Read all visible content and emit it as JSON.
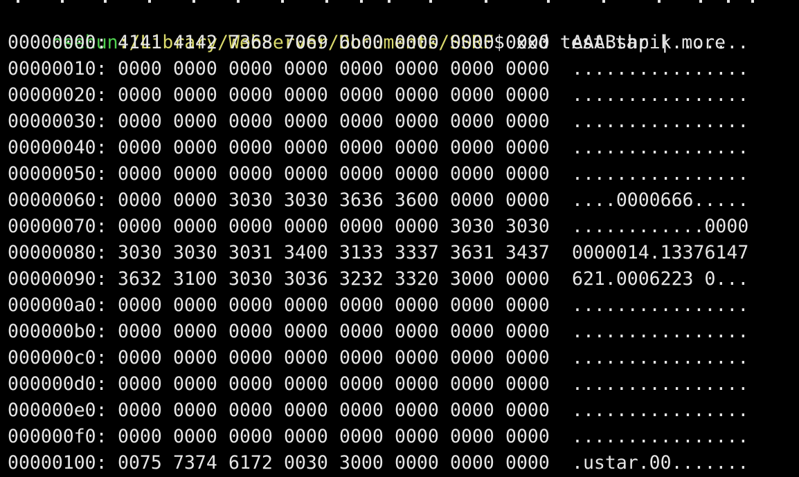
{
  "terminal": {
    "prompt": {
      "user": "osehun",
      "path": ":/Library/WebServer/Documents/SSRF",
      "symbol": "$",
      "command": " xxd test.tar | more"
    },
    "rows": [
      {
        "offset": "00000000:",
        "hex": [
          "4141",
          "4142",
          "7368",
          "7069",
          "6b00",
          "0000",
          "0000",
          "0000"
        ],
        "ascii": "AAABshpik......."
      },
      {
        "offset": "00000010:",
        "hex": [
          "0000",
          "0000",
          "0000",
          "0000",
          "0000",
          "0000",
          "0000",
          "0000"
        ],
        "ascii": "................"
      },
      {
        "offset": "00000020:",
        "hex": [
          "0000",
          "0000",
          "0000",
          "0000",
          "0000",
          "0000",
          "0000",
          "0000"
        ],
        "ascii": "................"
      },
      {
        "offset": "00000030:",
        "hex": [
          "0000",
          "0000",
          "0000",
          "0000",
          "0000",
          "0000",
          "0000",
          "0000"
        ],
        "ascii": "................"
      },
      {
        "offset": "00000040:",
        "hex": [
          "0000",
          "0000",
          "0000",
          "0000",
          "0000",
          "0000",
          "0000",
          "0000"
        ],
        "ascii": "................"
      },
      {
        "offset": "00000050:",
        "hex": [
          "0000",
          "0000",
          "0000",
          "0000",
          "0000",
          "0000",
          "0000",
          "0000"
        ],
        "ascii": "................"
      },
      {
        "offset": "00000060:",
        "hex": [
          "0000",
          "0000",
          "3030",
          "3030",
          "3636",
          "3600",
          "0000",
          "0000"
        ],
        "ascii": "....0000666....."
      },
      {
        "offset": "00000070:",
        "hex": [
          "0000",
          "0000",
          "0000",
          "0000",
          "0000",
          "0000",
          "3030",
          "3030"
        ],
        "ascii": "............0000"
      },
      {
        "offset": "00000080:",
        "hex": [
          "3030",
          "3030",
          "3031",
          "3400",
          "3133",
          "3337",
          "3631",
          "3437"
        ],
        "ascii": "0000014.13376147"
      },
      {
        "offset": "00000090:",
        "hex": [
          "3632",
          "3100",
          "3030",
          "3036",
          "3232",
          "3320",
          "3000",
          "0000"
        ],
        "ascii": "621.0006223 0..."
      },
      {
        "offset": "000000a0:",
        "hex": [
          "0000",
          "0000",
          "0000",
          "0000",
          "0000",
          "0000",
          "0000",
          "0000"
        ],
        "ascii": "................"
      },
      {
        "offset": "000000b0:",
        "hex": [
          "0000",
          "0000",
          "0000",
          "0000",
          "0000",
          "0000",
          "0000",
          "0000"
        ],
        "ascii": "................"
      },
      {
        "offset": "000000c0:",
        "hex": [
          "0000",
          "0000",
          "0000",
          "0000",
          "0000",
          "0000",
          "0000",
          "0000"
        ],
        "ascii": "................"
      },
      {
        "offset": "000000d0:",
        "hex": [
          "0000",
          "0000",
          "0000",
          "0000",
          "0000",
          "0000",
          "0000",
          "0000"
        ],
        "ascii": "................"
      },
      {
        "offset": "000000e0:",
        "hex": [
          "0000",
          "0000",
          "0000",
          "0000",
          "0000",
          "0000",
          "0000",
          "0000"
        ],
        "ascii": "................"
      },
      {
        "offset": "000000f0:",
        "hex": [
          "0000",
          "0000",
          "0000",
          "0000",
          "0000",
          "0000",
          "0000",
          "0000"
        ],
        "ascii": "................"
      },
      {
        "offset": "00000100:",
        "hex": [
          "0075",
          "7374",
          "6172",
          "0030",
          "3000",
          "0000",
          "0000",
          "0000"
        ],
        "ascii": ".ustar.00......."
      }
    ]
  },
  "colors": {
    "background": "#000000",
    "text": "#e6e6e6",
    "prompt_user": "#4fd14f",
    "prompt_path": "#d9d96b"
  }
}
